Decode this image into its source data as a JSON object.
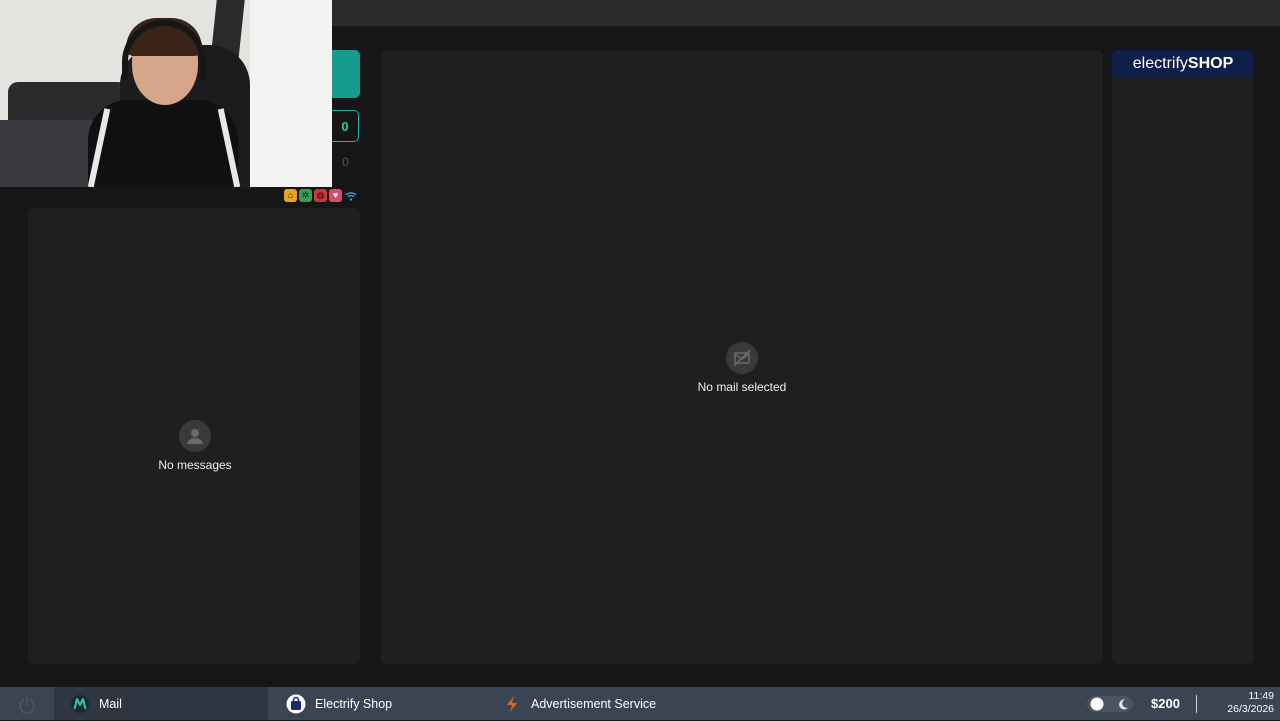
{
  "webcam": {
    "icon": "webcam-overlay"
  },
  "mail_sidebar": {
    "unread_count": "0",
    "other_count": "0",
    "status_icons": [
      "home-icon",
      "settings-icon",
      "alert-icon",
      "heart-icon",
      "wifi-icon"
    ]
  },
  "message_list": {
    "empty_text": "No messages",
    "icon": "person-icon"
  },
  "mail_viewer": {
    "empty_text": "No mail selected",
    "icon": "no-mail-icon"
  },
  "ad_panel": {
    "logo_regular": "electrify",
    "logo_bold": "SHOP"
  },
  "taskbar": {
    "apps": [
      {
        "label": "Mail",
        "icon": "mail-app-icon"
      },
      {
        "label": "Electrify Shop",
        "icon": "shop-bag-icon"
      },
      {
        "label": "Advertisement Service",
        "icon": "bolt-icon"
      }
    ],
    "balance": "$200",
    "time": "11:49",
    "date": "26/3/2026"
  },
  "colors": {
    "accent_teal": "#159c8f",
    "taskbar": "#3b4452",
    "panel": "#1f1f1f",
    "background": "#161616",
    "shop_logo_bg": "#0f1e4b"
  }
}
